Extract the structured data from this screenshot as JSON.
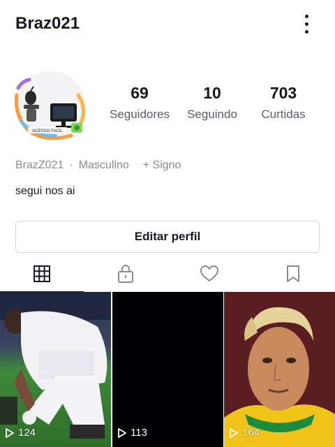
{
  "header": {
    "username": "Braz021"
  },
  "stats": [
    {
      "value": "69",
      "label": "Seguidores"
    },
    {
      "value": "10",
      "label": "Seguindo"
    },
    {
      "value": "703",
      "label": "Curtidas"
    }
  ],
  "profile": {
    "handle": "BrazZ021",
    "separator": "·",
    "gender": "Masculino",
    "sign": "+ Signo",
    "bio": "segui nos ai",
    "avatar_text": "ACESSO FACIL"
  },
  "edit_button": "Editar perfil",
  "tabs": [
    {
      "icon": "grid-icon",
      "active": true
    },
    {
      "icon": "lock-icon",
      "active": false
    },
    {
      "icon": "heart-icon",
      "active": false
    },
    {
      "icon": "bookmark-icon",
      "active": false
    }
  ],
  "videos": [
    {
      "views": "124"
    },
    {
      "views": "113"
    },
    {
      "views": "164"
    }
  ]
}
